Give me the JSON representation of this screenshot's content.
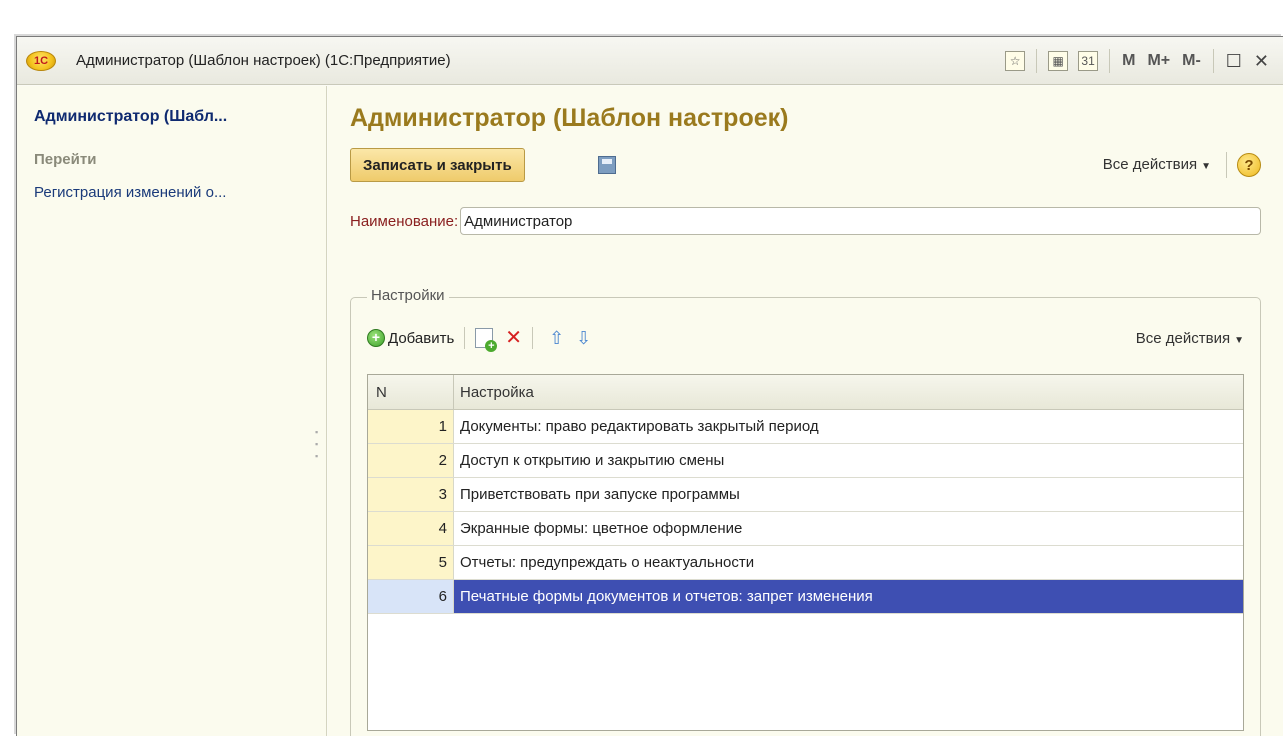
{
  "window": {
    "title": "Администратор (Шаблон настроек) (1С:Предприятие)",
    "logo_text": "1С",
    "tools": {
      "favorite_icon": "star-icon",
      "calculator_icon": "calculator-icon",
      "calendar_icon": "calendar-icon",
      "calendar_text": "31",
      "m_label": "M",
      "m_plus_label": "M+",
      "m_minus_label": "M-",
      "maximize_glyph": "☐",
      "close_glyph": "✕"
    }
  },
  "navigation": {
    "title": "Администратор (Шабл...",
    "section": "Перейти",
    "links": [
      "Регистрация изменений о..."
    ]
  },
  "form": {
    "title": "Администратор (Шаблон настроек)",
    "save_close_label": "Записать и закрыть",
    "all_actions_label": "Все действия",
    "help_glyph": "?",
    "name_label": "Наименование:",
    "name_value": "Администратор"
  },
  "settings_group": {
    "label": "Настройки",
    "toolbar": {
      "add_label": "Добавить",
      "all_actions_label": "Все действия"
    },
    "table": {
      "columns": [
        "N",
        "Настройка"
      ],
      "rows": [
        {
          "n": "1",
          "setting": "Документы: право редактировать закрытый период"
        },
        {
          "n": "2",
          "setting": "Доступ к открытию и закрытию смены"
        },
        {
          "n": "3",
          "setting": "Приветствовать при запуске программы"
        },
        {
          "n": "4",
          "setting": "Экранные формы: цветное оформление"
        },
        {
          "n": "5",
          "setting": "Отчеты: предупреждать о неактуальности"
        },
        {
          "n": "6",
          "setting": "Печатные формы документов и отчетов: запрет изменения"
        }
      ],
      "selected_row": 6
    }
  },
  "colors": {
    "form_title": "#9a7a1e",
    "selection": "#3e4fb2",
    "number_cell": "#fdf5c9"
  }
}
